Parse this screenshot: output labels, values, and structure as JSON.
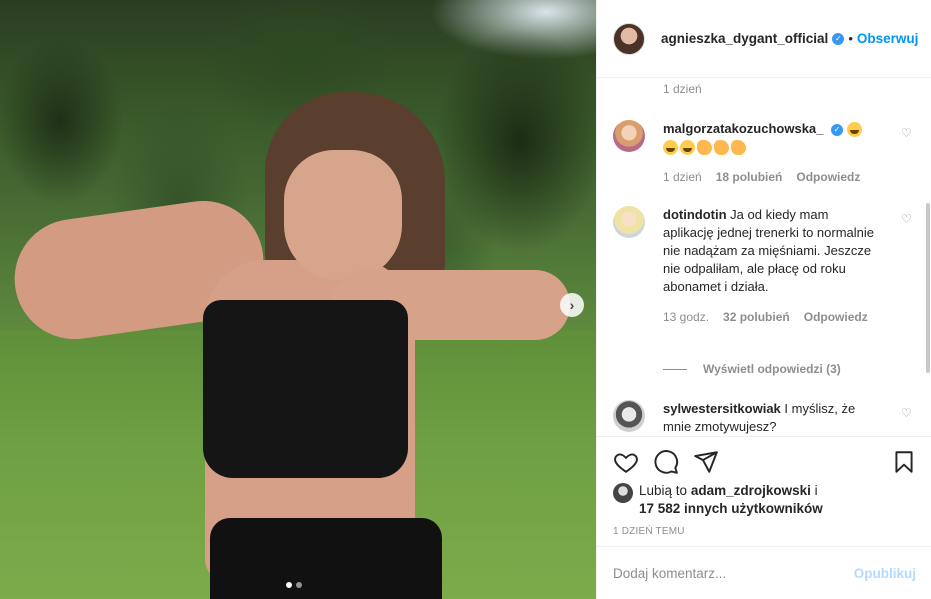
{
  "post": {
    "author": "agnieszka_dygant_official",
    "separator": "•",
    "follow_label": "Obserwuj",
    "image_count": 2,
    "active_image_index": 0
  },
  "comments_panel": {
    "top_time": "1 dzień",
    "comments": [
      {
        "username": "malgorzatakozuchowska_",
        "verified": true,
        "text": "",
        "emojis_line1": [
          "laugh"
        ],
        "emojis_line2": [
          "laugh",
          "laugh",
          "clap",
          "clap",
          "clap"
        ],
        "time": "1 dzień",
        "likes": "18 polubień",
        "reply": "Odpowiedz"
      },
      {
        "username": "dotindotin",
        "verified": false,
        "text": "Ja od kiedy mam aplikację jednej trenerki to normalnie nie nadążam za mięśniami. Jeszcze nie odpaliłam, ale płacę od roku abonamet i działa.",
        "time": "13 godz.",
        "likes": "32 polubień",
        "reply": "Odpowiedz"
      },
      {
        "username": "sylwestersitkowiak",
        "verified": false,
        "text": "I myślisz, że mnie zmotywujesz?"
      }
    ],
    "view_replies": "Wyświetl odpowiedzi (3)"
  },
  "likes": {
    "prefix": "Lubią to",
    "user": "adam_zdrojkowski",
    "conj": "i",
    "others": "17 582 innych użytkowników"
  },
  "date_label": "1 DZIEŃ TEMU",
  "add_comment": {
    "placeholder": "Dodaj komentarz...",
    "post_label": "Opublikuj"
  },
  "icons": {
    "like": "heart-icon",
    "comment": "comment-icon",
    "share": "share-icon",
    "save": "bookmark-icon",
    "next": "chevron-right-icon"
  },
  "colors": {
    "accent": "#0095f6",
    "verified": "#3897f0",
    "muted": "#8e8e8e",
    "post_disabled": "#b3dbff"
  }
}
